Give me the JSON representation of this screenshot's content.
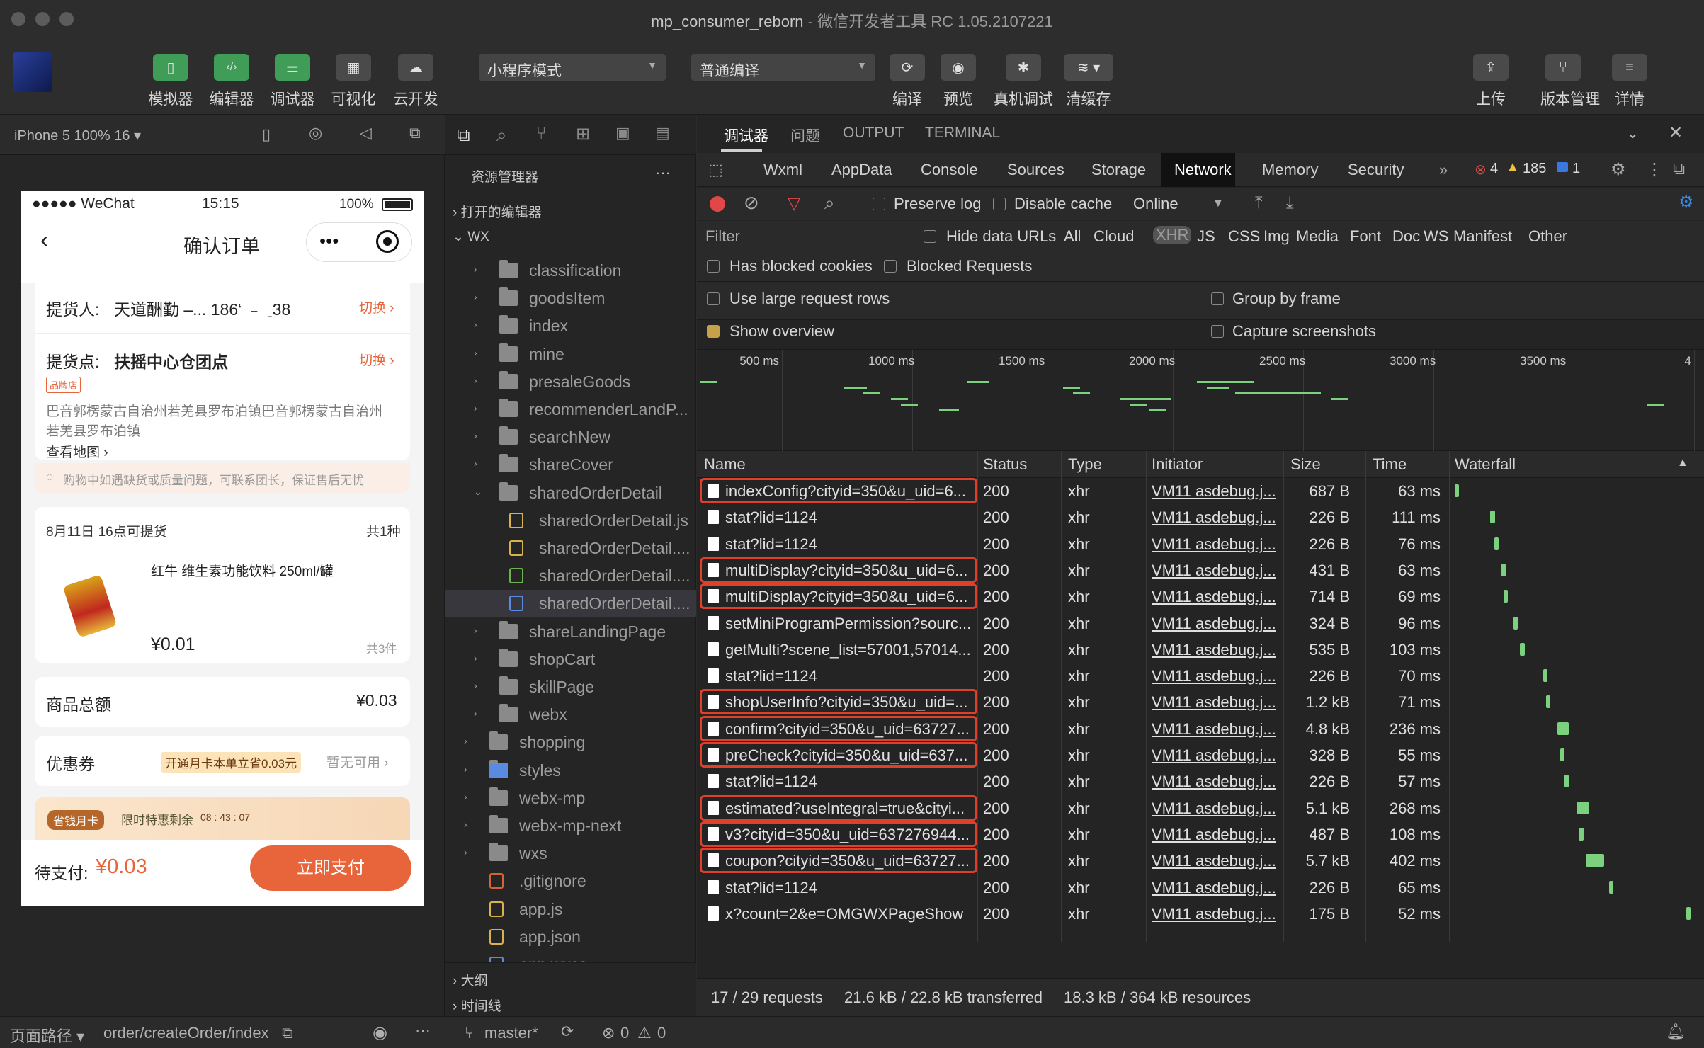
{
  "window": {
    "project": "mp_consumer_reborn",
    "app": "- 微信开发者工具 RC 1.05.2107221"
  },
  "toolbar": {
    "simulator": "模拟器",
    "editor": "编辑器",
    "debugger": "调试器",
    "visual": "可视化",
    "cloud": "云开发",
    "mode": "小程序模式",
    "compile_mode": "普通编译",
    "compile": "编译",
    "preview": "预览",
    "real_debug": "真机调试",
    "clear_cache": "清缓存",
    "upload": "上传",
    "version": "版本管理",
    "details": "详情"
  },
  "simulator": {
    "device": "iPhone 5 100% 16 ▾",
    "statusbar": {
      "carrier": "●●●●● WeChat",
      "time": "15:15",
      "battery": "100%"
    },
    "nav_title": "确认订单",
    "pickup_person_label": "提货人:",
    "pickup_person_value": "天道酬勤 –... 186‘   ﹣ ˍ38",
    "switch1": "切换 ›",
    "pickup_point_label": "提货点:",
    "pickup_point_value": "扶摇中心仓团点",
    "switch2": "切换 ›",
    "brand_tag": "品牌店",
    "address_line1": "巴音郭楞蒙古自治州若羌县罗布泊镇巴音郭楞蒙古自治州",
    "address_line2": "若羌县罗布泊镇",
    "view_map": "查看地图 ›",
    "notice": "购物中如遇缺货或质量问题，可联系团长，保证售后无忧",
    "pickup_date": "8月11日 16点可提货",
    "kinds": "共1种",
    "product_name": "红牛 维生素功能饮料 250ml/罐",
    "product_price": "¥0.01",
    "product_count": "共3件",
    "total_label": "商品总额",
    "total_value": "¥0.03",
    "coupon_label": "优惠券",
    "coupon_promo": "开通月卡本单立省0.03元",
    "coupon_status": "暂无可用 ›",
    "monthly_card": "省钱月卡",
    "limited": "限时特惠剩余",
    "countdown": "08 : 43 : 07",
    "pay_label": "待支付:",
    "pay_value": "¥0.03",
    "pay_button": "立即支付"
  },
  "explorer": {
    "title": "资源管理器",
    "more": "···",
    "open_editors": "打开的编辑器",
    "root": "WX",
    "items": [
      {
        "name": "classification",
        "kind": "folder",
        "depth": 1
      },
      {
        "name": "goodsItem",
        "kind": "folder",
        "depth": 1
      },
      {
        "name": "index",
        "kind": "folder",
        "depth": 1
      },
      {
        "name": "mine",
        "kind": "folder",
        "depth": 1
      },
      {
        "name": "presaleGoods",
        "kind": "folder",
        "depth": 1
      },
      {
        "name": "recommenderLandP...",
        "kind": "folder",
        "depth": 1
      },
      {
        "name": "searchNew",
        "kind": "folder",
        "depth": 1
      },
      {
        "name": "shareCover",
        "kind": "folder",
        "depth": 1
      },
      {
        "name": "sharedOrderDetail",
        "kind": "folder-open",
        "depth": 1
      },
      {
        "name": "sharedOrderDetail.js",
        "kind": "js",
        "depth": 2
      },
      {
        "name": "sharedOrderDetail....",
        "kind": "json",
        "depth": 2
      },
      {
        "name": "sharedOrderDetail....",
        "kind": "wxml",
        "depth": 2
      },
      {
        "name": "sharedOrderDetail....",
        "kind": "wxss",
        "depth": 2
      },
      {
        "name": "shareLandingPage",
        "kind": "folder",
        "depth": 1
      },
      {
        "name": "shopCart",
        "kind": "folder",
        "depth": 1
      },
      {
        "name": "skillPage",
        "kind": "folder",
        "depth": 1
      },
      {
        "name": "webx",
        "kind": "folder",
        "depth": 1
      },
      {
        "name": "shopping",
        "kind": "folder",
        "depth": 0
      },
      {
        "name": "styles",
        "kind": "folder-blue",
        "depth": 0
      },
      {
        "name": "webx-mp",
        "kind": "folder",
        "depth": 0
      },
      {
        "name": "webx-mp-next",
        "kind": "folder",
        "depth": 0
      },
      {
        "name": "wxs",
        "kind": "folder",
        "depth": 0
      },
      {
        "name": ".gitignore",
        "kind": "git",
        "depth": 0
      },
      {
        "name": "app.js",
        "kind": "js",
        "depth": 0
      },
      {
        "name": "app.json",
        "kind": "json",
        "depth": 0
      },
      {
        "name": "app.wxss",
        "kind": "wxss",
        "depth": 0
      }
    ],
    "outline": "大纲",
    "timeline": "时间线"
  },
  "devtools": {
    "tabs": [
      "调试器",
      "问题",
      "OUTPUT",
      "TERMINAL"
    ],
    "panels": [
      "Wxml",
      "AppData",
      "Console",
      "Sources",
      "Storage",
      "Network",
      "Memory",
      "Security"
    ],
    "errors": "4",
    "warnings": "185",
    "infos": "1",
    "preserve_log": "Preserve log",
    "disable_cache": "Disable cache",
    "throttle": "Online",
    "filter": "Filter",
    "hide_data_urls": "Hide data URLs",
    "types": [
      "All",
      "Cloud",
      "XHR",
      "JS",
      "CSS",
      "Img",
      "Media",
      "Font",
      "Doc",
      "WS",
      "Manifest",
      "Other"
    ],
    "has_blocked": "Has blocked cookies",
    "blocked_requests": "Blocked Requests",
    "large_rows": "Use large request rows",
    "group_by_frame": "Group by frame",
    "show_overview": "Show overview",
    "capture_screenshots": "Capture screenshots",
    "timeline_ticks": [
      "500 ms",
      "1000 ms",
      "1500 ms",
      "2000 ms",
      "2500 ms",
      "3000 ms",
      "3500 ms",
      "4"
    ],
    "columns": {
      "name": "Name",
      "status": "Status",
      "type": "Type",
      "initiator": "Initiator",
      "size": "Size",
      "time": "Time",
      "waterfall": "Waterfall"
    },
    "rows": [
      {
        "name": "indexConfig?cityid=350&u_uid=6...",
        "status": "200",
        "type": "xhr",
        "initiator": "VM11 asdebug.j...",
        "size": "687 B",
        "time": "63 ms",
        "highlight": true,
        "wf": 0.0
      },
      {
        "name": "stat?lid=1124",
        "status": "200",
        "type": "xhr",
        "initiator": "VM11 asdebug.j...",
        "size": "226 B",
        "time": "111 ms",
        "highlight": false,
        "wf": 0.15
      },
      {
        "name": "stat?lid=1124",
        "status": "200",
        "type": "xhr",
        "initiator": "VM11 asdebug.j...",
        "size": "226 B",
        "time": "76 ms",
        "highlight": false,
        "wf": 0.17
      },
      {
        "name": "multiDisplay?cityid=350&u_uid=6...",
        "status": "200",
        "type": "xhr",
        "initiator": "VM11 asdebug.j...",
        "size": "431 B",
        "time": "63 ms",
        "highlight": true,
        "wf": 0.2
      },
      {
        "name": "multiDisplay?cityid=350&u_uid=6...",
        "status": "200",
        "type": "xhr",
        "initiator": "VM11 asdebug.j...",
        "size": "714 B",
        "time": "69 ms",
        "highlight": true,
        "wf": 0.21
      },
      {
        "name": "setMiniProgramPermission?sourc...",
        "status": "200",
        "type": "xhr",
        "initiator": "VM11 asdebug.j...",
        "size": "324 B",
        "time": "96 ms",
        "highlight": false,
        "wf": 0.25
      },
      {
        "name": "getMulti?scene_list=57001,57014...",
        "status": "200",
        "type": "xhr",
        "initiator": "VM11 asdebug.j...",
        "size": "535 B",
        "time": "103 ms",
        "highlight": false,
        "wf": 0.28
      },
      {
        "name": "stat?lid=1124",
        "status": "200",
        "type": "xhr",
        "initiator": "VM11 asdebug.j...",
        "size": "226 B",
        "time": "70 ms",
        "highlight": false,
        "wf": 0.38
      },
      {
        "name": "shopUserInfo?cityid=350&u_uid=...",
        "status": "200",
        "type": "xhr",
        "initiator": "VM11 asdebug.j...",
        "size": "1.2 kB",
        "time": "71 ms",
        "highlight": true,
        "wf": 0.39
      },
      {
        "name": "confirm?cityid=350&u_uid=63727...",
        "status": "200",
        "type": "xhr",
        "initiator": "VM11 asdebug.j...",
        "size": "4.8 kB",
        "time": "236 ms",
        "highlight": true,
        "wf": 0.44
      },
      {
        "name": "preCheck?cityid=350&u_uid=637...",
        "status": "200",
        "type": "xhr",
        "initiator": "VM11 asdebug.j...",
        "size": "328 B",
        "time": "55 ms",
        "highlight": true,
        "wf": 0.45
      },
      {
        "name": "stat?lid=1124",
        "status": "200",
        "type": "xhr",
        "initiator": "VM11 asdebug.j...",
        "size": "226 B",
        "time": "57 ms",
        "highlight": false,
        "wf": 0.47
      },
      {
        "name": "estimated?useIntegral=true&cityi...",
        "status": "200",
        "type": "xhr",
        "initiator": "VM11 asdebug.j...",
        "size": "5.1 kB",
        "time": "268 ms",
        "highlight": true,
        "wf": 0.52
      },
      {
        "name": "v3?cityid=350&u_uid=637276944...",
        "status": "200",
        "type": "xhr",
        "initiator": "VM11 asdebug.j...",
        "size": "487 B",
        "time": "108 ms",
        "highlight": true,
        "wf": 0.53
      },
      {
        "name": "coupon?cityid=350&u_uid=63727...",
        "status": "200",
        "type": "xhr",
        "initiator": "VM11 asdebug.j...",
        "size": "5.7 kB",
        "time": "402 ms",
        "highlight": true,
        "wf": 0.56
      },
      {
        "name": "stat?lid=1124",
        "status": "200",
        "type": "xhr",
        "initiator": "VM11 asdebug.j...",
        "size": "226 B",
        "time": "65 ms",
        "highlight": false,
        "wf": 0.66
      },
      {
        "name": "x?count=2&e=OMGWXPageShow",
        "status": "200",
        "type": "xhr",
        "initiator": "VM11 asdebug.j...",
        "size": "175 B",
        "time": "52 ms",
        "highlight": false,
        "wf": 0.99
      }
    ],
    "summary_requests": "17 / 29 requests",
    "summary_transferred": "21.6 kB / 22.8 kB transferred",
    "summary_resources": "18.3 kB / 364 kB resources"
  },
  "statusbar": {
    "page_path_label": "页面路径 ▾",
    "page_path": "order/createOrder/index",
    "branch": "master*",
    "errors": "0",
    "warnings": "0"
  },
  "colors": {
    "green": "#3f9d58",
    "accent_red": "#e0402a",
    "network_bar": "#7bd17e",
    "pay_orange": "#e8643a"
  }
}
